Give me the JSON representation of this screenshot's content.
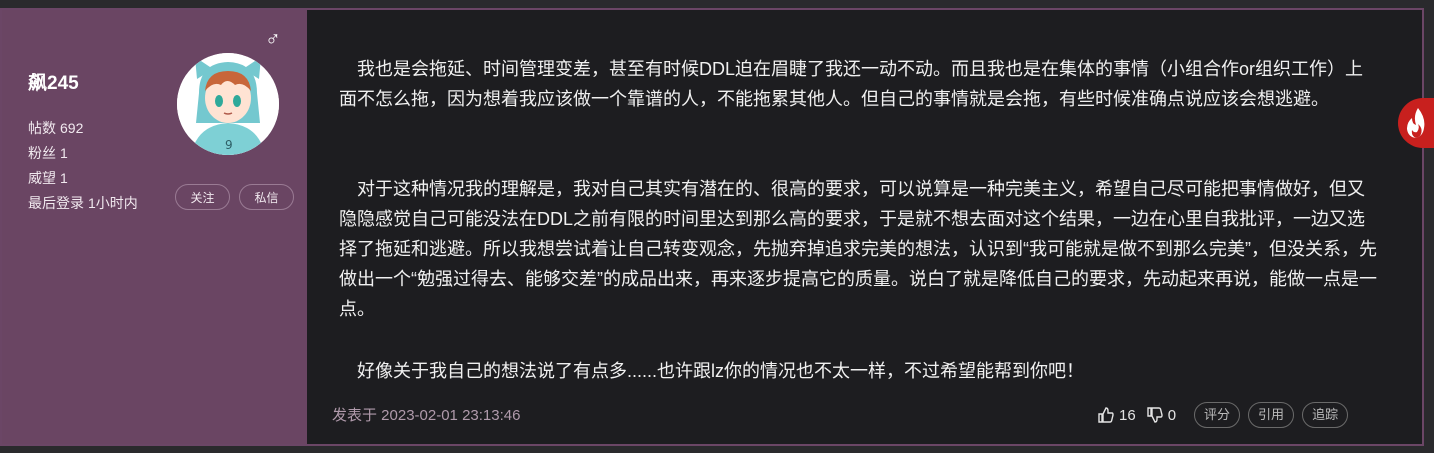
{
  "user": {
    "name": "飙245",
    "gender_symbol": "♂",
    "stats": [
      {
        "label": "帖数",
        "value": "692"
      },
      {
        "label": "粉丝",
        "value": "1"
      },
      {
        "label": "威望",
        "value": "1"
      },
      {
        "label": "最后登录",
        "value": "1小时内"
      }
    ],
    "follow_label": "关注",
    "message_label": "私信"
  },
  "post": {
    "paragraphs": [
      "　我也是会拖延、时间管理变差，甚至有时候DDL迫在眉睫了我还一动不动。而且我也是在集体的事情（小组合作or组织工作）上面不怎么拖，因为想着我应该做一个靠谱的人，不能拖累其他人。但自己的事情就是会拖，有些时候准确点说应该会想逃避。",
      "　对于这种情况我的理解是，我对自己其实有潜在的、很高的要求，可以说算是一种完美主义，希望自己尽可能把事情做好，但又隐隐感觉自己可能没法在DDL之前有限的时间里达到那么高的要求，于是就不想去面对这个结果，一边在心里自我批评，一边又选择了拖延和逃避。所以我想尝试着让自己转变观念，先抛弃掉追求完美的想法，认识到“我可能就是做不到那么完美”，但没关系，先做出一个“勉强过得去、能够交差”的成品出来，再来逐步提高它的质量。说白了就是降低自己的要求，先动起来再说，能做一点是一点。",
      "　好像关于我自己的想法说了有点多......也许跟lz你的情况也不太一样，不过希望能帮到你吧！"
    ],
    "posted_at": "发表于 2023-02-01 23:13:46",
    "likes": "16",
    "dislikes": "0",
    "rate_label": "评分",
    "quote_label": "引用",
    "track_label": "追踪"
  },
  "icons": {
    "like": "thumbs-up-icon",
    "dislike": "thumbs-down-icon",
    "fire": "fire-icon",
    "gender": "male-icon"
  },
  "colors": {
    "sidebar": "#6a4563",
    "content_bg": "#1d1d20",
    "fire": "#c8201e"
  }
}
